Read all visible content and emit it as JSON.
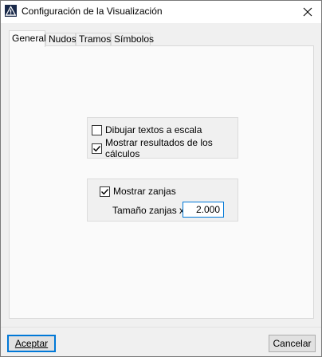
{
  "window": {
    "title": "Configuración de la Visualización",
    "app_icon": "warning-triangle-icon",
    "close_icon": "close-icon"
  },
  "tabs": [
    {
      "label": "General",
      "active": true
    },
    {
      "label": "Nudos",
      "active": false
    },
    {
      "label": "Tramos",
      "active": false
    },
    {
      "label": "Símbolos",
      "active": false
    }
  ],
  "display_options": {
    "draw_scaled_text": {
      "label": "Dibujar textos a escala",
      "checked": false
    },
    "show_results": {
      "label": "Mostrar resultados de los cálculos",
      "checked": true
    }
  },
  "trenches": {
    "show_trenches": {
      "label": "Mostrar zanjas",
      "checked": true
    },
    "size_label": "Tamaño zanjas x",
    "size_value": "2.000"
  },
  "buttons": {
    "accept_label": "Aceptar",
    "cancel_label": "Cancelar"
  },
  "colors": {
    "focus_accent": "#0078d7",
    "dialog_bg": "#f0f0f0"
  }
}
